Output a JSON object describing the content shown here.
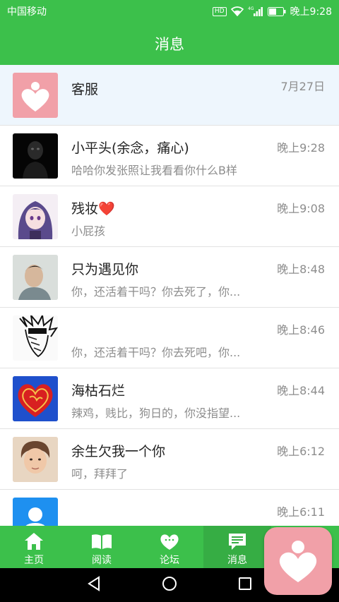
{
  "status_bar": {
    "carrier": "中国移动",
    "hd_badge": "HD",
    "network": "4G",
    "time": "晚上9:28"
  },
  "header": {
    "title": "消息"
  },
  "messages": [
    {
      "name": "客服",
      "preview": "",
      "time": "7月27日",
      "avatar": "heart-logo-avatar",
      "pinned": true
    },
    {
      "name": "小平头(余念，痛心)",
      "preview": "哈哈你发张照让我看看你什么B样",
      "time": "晚上9:28",
      "avatar": "dark-figure-avatar"
    },
    {
      "name": "残妆❤️",
      "preview": "小屁孩",
      "time": "晚上9:08",
      "avatar": "anime-girl-avatar"
    },
    {
      "name": "只为遇见你",
      "preview": "你，还活着干吗？你去死了，你...",
      "time": "晚上8:48",
      "avatar": "man-photo-avatar"
    },
    {
      "name": "",
      "preview": "你，还活着干吗？你去死吧，你...",
      "time": "晚上8:46",
      "avatar": "manga-sketch-avatar"
    },
    {
      "name": "海枯石烂",
      "preview": "辣鸡，贱比，狗日的，你没指望...",
      "time": "晚上8:44",
      "avatar": "red-heart-avatar"
    },
    {
      "name": "余生欠我一个你",
      "preview": "呵，拜拜了",
      "time": "晚上6:12",
      "avatar": "young-man-avatar"
    },
    {
      "name": "",
      "preview": "",
      "time": "晚上6:11",
      "avatar": "default-user-avatar"
    }
  ],
  "tabbar": {
    "tabs": [
      {
        "label": "主页",
        "icon": "home-icon"
      },
      {
        "label": "阅读",
        "icon": "book-icon"
      },
      {
        "label": "论坛",
        "icon": "forum-icon"
      },
      {
        "label": "消息",
        "icon": "message-icon",
        "active": true
      }
    ]
  },
  "colors": {
    "primary_green": "#3cc04b",
    "floating_pink": "#f1a0a8"
  }
}
